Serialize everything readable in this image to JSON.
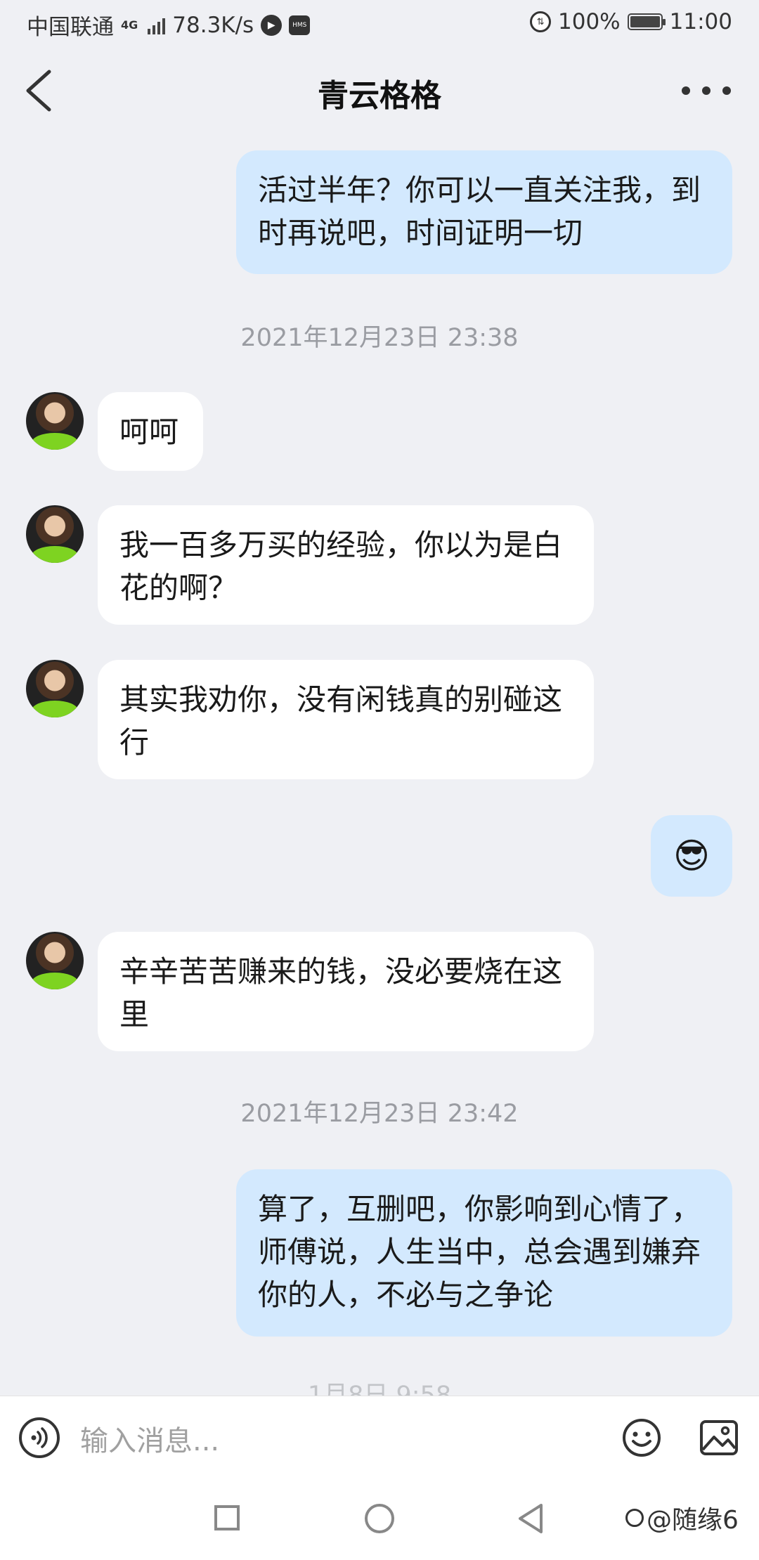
{
  "status_bar": {
    "carrier": "中国联通",
    "network": "4G",
    "speed": "78.3K/s",
    "battery": "100%",
    "time": "11:00"
  },
  "header": {
    "title": "青云格格"
  },
  "messages": {
    "sent_1": "活过半年？你可以一直关注我，到时再说吧，时间证明一切",
    "ts_1": "2021年12月23日 23:38",
    "recv_1": "呵呵",
    "recv_2": "我一百多万买的经验，你以为是白花的啊？",
    "recv_3": "其实我劝你，没有闲钱真的别碰这行",
    "sent_2": "😎",
    "recv_4": "辛辛苦苦赚来的钱，没必要烧在这里",
    "ts_2": "2021年12月23日 23:42",
    "sent_3": "算了，互删吧，你影响到心情了，师傅说，人生当中，总会遇到嫌弃你的人，不必与之争论",
    "ts_3_partial": "1月8日 9:58"
  },
  "input": {
    "placeholder": "输入消息..."
  },
  "watermark": {
    "text": "@随缘6"
  }
}
